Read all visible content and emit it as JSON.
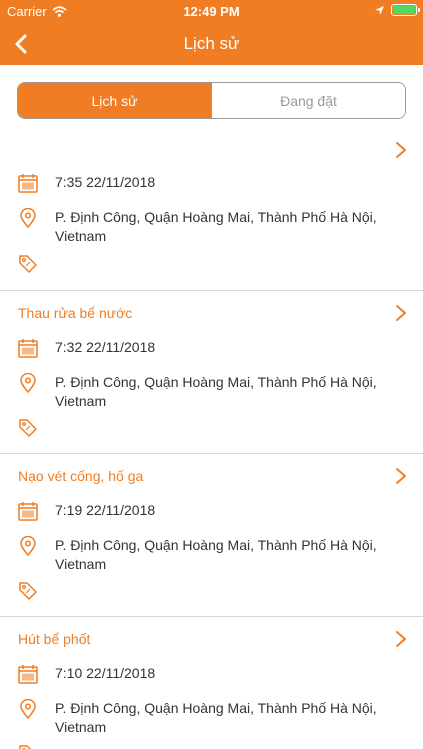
{
  "status_bar": {
    "carrier": "Carrier",
    "time": "12:49 PM"
  },
  "nav": {
    "title": "Lịch sử"
  },
  "tabs": [
    {
      "label": "Lịch sử",
      "active": true
    },
    {
      "label": "Đang đặt",
      "active": false
    }
  ],
  "items": [
    {
      "title": "",
      "datetime": "7:35 22/11/2018",
      "address_line1": "P. Định Công, Quận Hoàng Mai, Thành Phố Hà Nội,",
      "address_line2": "Vietnam"
    },
    {
      "title": "Thau rửa bể nước",
      "datetime": "7:32 22/11/2018",
      "address_line1": "P. Định Công, Quận Hoàng Mai, Thành Phố Hà Nội,",
      "address_line2": "Vietnam"
    },
    {
      "title": "Nạo vét cống, hố ga",
      "datetime": "7:19 22/11/2018",
      "address_line1": "P. Định Công, Quận Hoàng Mai, Thành Phố Hà Nội,",
      "address_line2": "Vietnam"
    },
    {
      "title": "Hút bể phốt",
      "datetime": "7:10 22/11/2018",
      "address_line1": "P. Định Công, Quận Hoàng Mai, Thành Phố Hà Nội,",
      "address_line2": "Vietnam"
    }
  ],
  "colors": {
    "accent": "#f07d23",
    "battery": "#4cd964",
    "divider": "#d8d8d8"
  },
  "icons": {
    "back": "chevron-left-icon",
    "item_arrow": "chevron-right-icon",
    "date": "calendar-icon",
    "address": "location-pin-icon",
    "tag": "tag-icon"
  }
}
